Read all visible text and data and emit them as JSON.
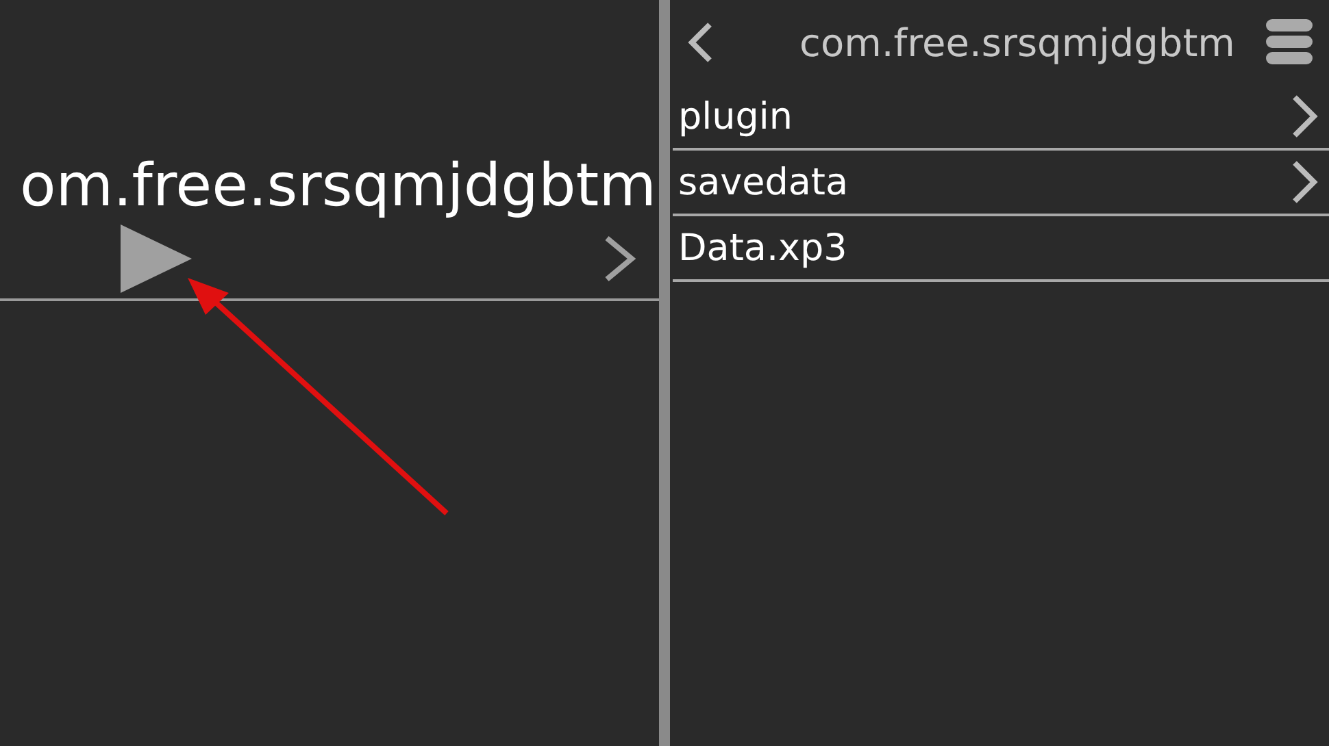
{
  "left_panel": {
    "title": "om.free.srsqmjdgbtm"
  },
  "right_panel": {
    "title": "com.free.srsqmjdgbtm",
    "items": [
      {
        "name": "plugin",
        "kind": "folder"
      },
      {
        "name": "savedata",
        "kind": "folder"
      },
      {
        "name": "Data.xp3",
        "kind": "file"
      }
    ]
  }
}
